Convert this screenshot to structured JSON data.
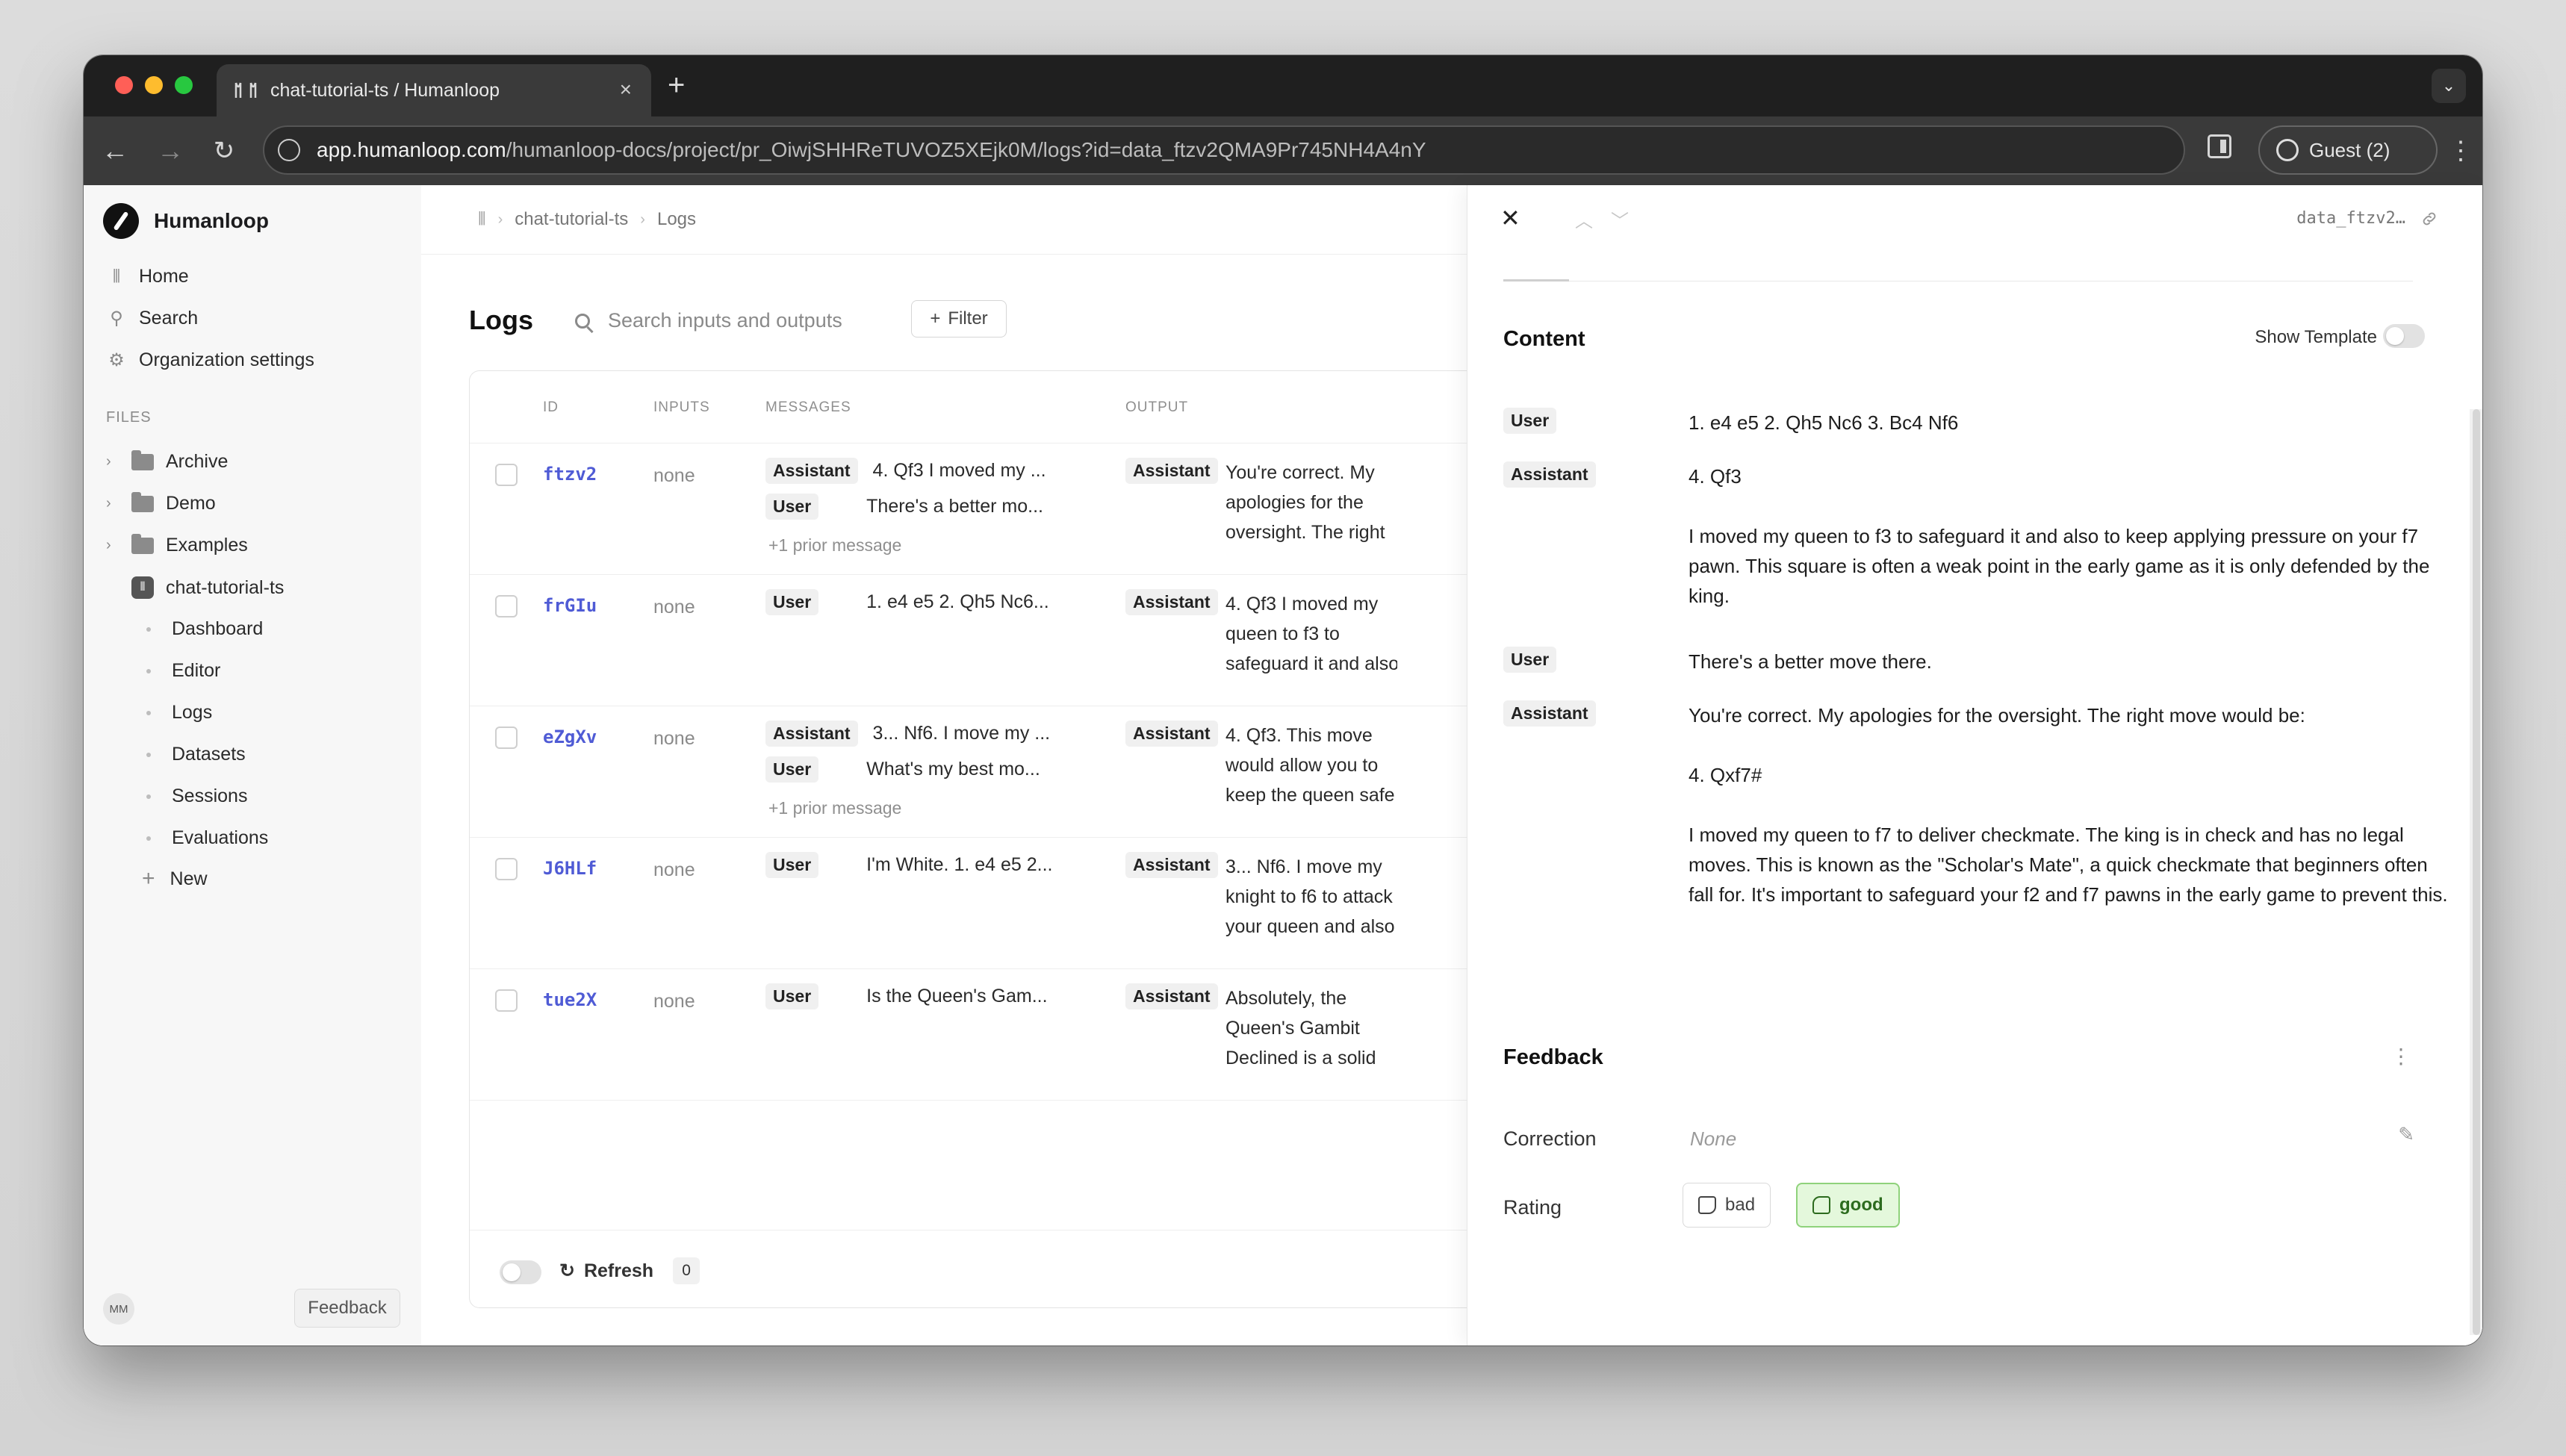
{
  "browser": {
    "tab_title": "chat-tutorial-ts / Humanloop",
    "tab_close": "×",
    "new_tab": "+",
    "url_host": "app.humanloop.com",
    "url_path": "/humanloop-docs/project/pr_OiwjSHHReTUVOZ5XEjk0M/logs?id=data_ftzv2QMA9Pr745NH4A4nY",
    "guest_label": "Guest (2)",
    "colors": {
      "red": "#ff5f57",
      "yellow": "#febc2e",
      "green": "#28c840"
    }
  },
  "sidebar": {
    "brand": "Humanloop",
    "nav": [
      {
        "label": "Home",
        "icon": "home-icon"
      },
      {
        "label": "Search",
        "icon": "search-icon"
      },
      {
        "label": "Organization settings",
        "icon": "gear-icon"
      }
    ],
    "files_label": "FILES",
    "folders": [
      "Archive",
      "Demo",
      "Examples"
    ],
    "project": "chat-tutorial-ts",
    "project_items": [
      "Dashboard",
      "Editor",
      "Logs",
      "Datasets",
      "Sessions",
      "Evaluations"
    ],
    "new_label": "New",
    "avatar": "MM",
    "feedback": "Feedback"
  },
  "main": {
    "breadcrumb": {
      "project": "chat-tutorial-ts",
      "page": "Logs"
    },
    "title": "Logs",
    "search_placeholder": "Search inputs and outputs",
    "filter_label": "Filter",
    "columns": {
      "id": "ID",
      "inputs": "INPUTS",
      "messages": "MESSAGES",
      "output": "OUTPUT"
    },
    "rows": [
      {
        "id": "ftzv2",
        "inputs": "none",
        "messages": [
          {
            "role": "Assistant",
            "text": "4. Qf3 I moved my ..."
          },
          {
            "role": "User",
            "text": "There's a better mo..."
          }
        ],
        "prior": "+1 prior message",
        "output_role": "Assistant",
        "output_lines": [
          "You're correct. My",
          "apologies for the",
          "oversight. The right"
        ]
      },
      {
        "id": "frGIu",
        "inputs": "none",
        "messages": [
          {
            "role": "User",
            "text": "1. e4 e5 2. Qh5 Nc6..."
          }
        ],
        "prior": "",
        "output_role": "Assistant",
        "output_lines": [
          "4. Qf3 I moved my",
          "queen to f3 to",
          "safeguard it and also"
        ]
      },
      {
        "id": "eZgXv",
        "inputs": "none",
        "messages": [
          {
            "role": "Assistant",
            "text": "3... Nf6. I move my ..."
          },
          {
            "role": "User",
            "text": "What's my best mo..."
          }
        ],
        "prior": "+1 prior message",
        "output_role": "Assistant",
        "output_lines": [
          "4. Qf3. This move",
          "would allow you to",
          "keep the queen safe"
        ]
      },
      {
        "id": "J6HLf",
        "inputs": "none",
        "messages": [
          {
            "role": "User",
            "text": "I'm White. 1. e4 e5 2..."
          }
        ],
        "prior": "",
        "output_role": "Assistant",
        "output_lines": [
          "3... Nf6. I move my",
          "knight to f6 to attack",
          "your queen and also"
        ]
      },
      {
        "id": "tue2X",
        "inputs": "none",
        "messages": [
          {
            "role": "User",
            "text": "Is the Queen's Gam..."
          }
        ],
        "prior": "",
        "output_role": "Assistant",
        "output_lines": [
          "Absolutely, the",
          "Queen's Gambit",
          "Declined is a solid"
        ]
      }
    ],
    "footer": {
      "refresh": "Refresh",
      "count": "0"
    }
  },
  "panel": {
    "log_id": "data_ftzv2…",
    "content_title": "Content",
    "show_template": "Show Template",
    "messages": [
      {
        "role": "User",
        "paragraphs": [
          "1. e4 e5 2. Qh5 Nc6 3. Bc4 Nf6"
        ]
      },
      {
        "role": "Assistant",
        "paragraphs": [
          "4. Qf3",
          "I moved my queen to f3 to safeguard it and also to keep applying pressure on your f7 pawn. This square is often a weak point in the early game as it is only defended by the king."
        ]
      },
      {
        "role": "User",
        "paragraphs": [
          "There's a better move there."
        ]
      },
      {
        "role": "Assistant",
        "paragraphs": [
          "You're correct. My apologies for the oversight. The right move would be:",
          "4. Qxf7#",
          "I moved my queen to f7 to deliver checkmate. The king is in check and has no legal moves. This is known as the \"Scholar's Mate\", a quick checkmate that beginners often fall for. It's important to safeguard your f2 and f7 pawns in the early game to prevent this."
        ]
      }
    ],
    "feedback_title": "Feedback",
    "correction_label": "Correction",
    "correction_value": "None",
    "rating_label": "Rating",
    "rating_bad": "bad",
    "rating_good": "good",
    "rating_selected": "good",
    "colors": {
      "good_bg": "#e4f8dc",
      "good_border": "#8fd27b",
      "good_text": "#2c6b1e"
    }
  }
}
